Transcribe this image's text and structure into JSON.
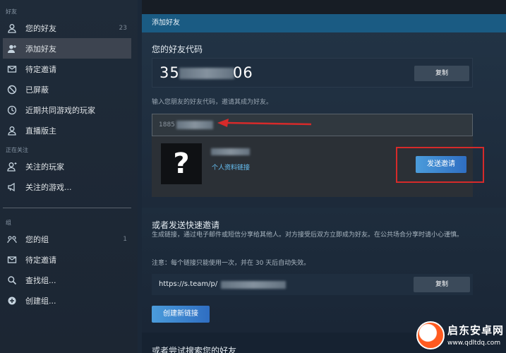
{
  "sidebar": {
    "friends_section": "好友",
    "friends_items": [
      {
        "label": "您的好友",
        "count": "23",
        "icon": "person-icon"
      },
      {
        "label": "添加好友",
        "icon": "person-add-icon"
      },
      {
        "label": "待定邀请",
        "icon": "envelope-icon"
      },
      {
        "label": "已屏蔽",
        "icon": "block-icon"
      },
      {
        "label": "近期共同游戏的玩家",
        "icon": "clock-icon"
      },
      {
        "label": "直播版主",
        "icon": "person-icon"
      }
    ],
    "following_section": "正在关注",
    "following_items": [
      {
        "label": "关注的玩家",
        "icon": "person-follow-icon"
      },
      {
        "label": "关注的游戏...",
        "icon": "megaphone-icon"
      }
    ],
    "groups_section": "组",
    "groups_items": [
      {
        "label": "您的组",
        "count": "1",
        "icon": "group-icon"
      },
      {
        "label": "待定邀请",
        "icon": "envelope-icon"
      },
      {
        "label": "查找组...",
        "icon": "search-icon"
      },
      {
        "label": "创建组...",
        "icon": "plus-circle-icon"
      }
    ]
  },
  "add_friend": {
    "header": "添加好友",
    "code_title": "您的好友代码",
    "code_prefix": "35",
    "code_suffix": "06",
    "copy_label": "复制",
    "hint": "输入您朋友的好友代码，邀请其成为好友。",
    "input_value": "1885",
    "avatar_glyph": "?",
    "profile_link": "个人资料链接",
    "send_label": "发送邀请"
  },
  "quick_invite": {
    "title": "或者发送快速邀请",
    "desc": "生成链接，通过电子邮件或短信分享给其他人。对方接受后双方立即成为好友。在公共场合分享时请小心谨慎。",
    "note": "注意：每个链接只能使用一次，并在 30 天后自动失效。",
    "link": "https://s.team/p/",
    "copy_label": "复制",
    "create_label": "创建新链接"
  },
  "search": {
    "title": "或者尝试搜索您的好友"
  },
  "watermark": {
    "title": "启东安卓网",
    "url": "www.qdltdq.com"
  },
  "colors": {
    "accent_blue": "#1a5b83",
    "link_blue": "#67c1f5",
    "highlight_red": "#d62a2a"
  }
}
